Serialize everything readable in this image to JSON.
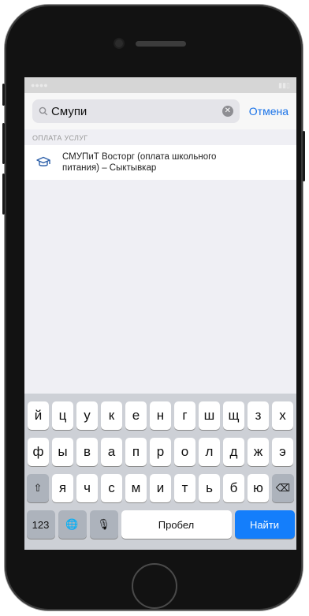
{
  "search": {
    "value": "Смупи",
    "clear_icon": "clear-icon",
    "cancel_label": "Отмена"
  },
  "section": {
    "title": "ОПЛАТА УСЛУГ"
  },
  "results": [
    {
      "icon": "graduation-cap-icon",
      "line1": "СМУПиТ Восторг (оплата школьного",
      "line2": "питания) – Сыктывкар"
    }
  ],
  "keyboard": {
    "row1": [
      "й",
      "ц",
      "у",
      "к",
      "е",
      "н",
      "г",
      "ш",
      "щ",
      "з",
      "х"
    ],
    "row2": [
      "ф",
      "ы",
      "в",
      "а",
      "п",
      "р",
      "о",
      "л",
      "д",
      "ж",
      "э"
    ],
    "row3": [
      "я",
      "ч",
      "с",
      "м",
      "и",
      "т",
      "ь",
      "б",
      "ю"
    ],
    "numbers_label": "123",
    "space_label": "Пробел",
    "search_label": "Найти"
  },
  "colors": {
    "accent": "#147efb",
    "link": "#1a73e8",
    "icon": "#2b5ea8"
  }
}
